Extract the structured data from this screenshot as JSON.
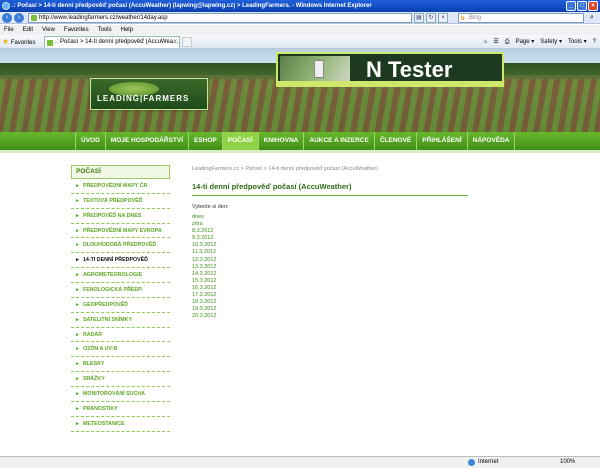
{
  "window": {
    "title": ".: Počasí > 14-ti denní předpověď počasí (AccuWeather) (lapwing@lapwing.cz) > LeadingFarmers. - Windows Internet Explorer"
  },
  "browser": {
    "url": "http://www.leadingfarmers.cz/weather/14day.asp",
    "search_placeholder": "Bing",
    "menu": [
      "File",
      "Edit",
      "View",
      "Favorites",
      "Tools",
      "Help"
    ],
    "favorites_label": "Favorites",
    "tab_title": ".: Počasí > 14-ti denní předpověď (AccuWea...",
    "commands": [
      "Page ▾",
      "Safety ▾",
      "Tools ▾"
    ],
    "status_zone": "Internet",
    "zoom": "100%"
  },
  "site": {
    "logo_text": "LEADING|FARMERS",
    "ad_title": "N Tester",
    "nav": [
      "ÚVOD",
      "MOJE HOSPODÁŘSTVÍ",
      "ESHOP",
      "POČASÍ",
      "KNIHOVNA",
      "AUKCE A INZERCE",
      "ČLENOVÉ",
      "PŘIHLÁŠENÍ",
      "NÁPOVĚDA"
    ],
    "nav_active_index": 3
  },
  "sidebar": {
    "title": "POČASÍ",
    "items": [
      "PŘEDPOVĚDNÍ MAPY ČR",
      "TEXTOVÁ PŘEDPOVĚĎ",
      "PŘEDPOVĚĎ NA DNES",
      "PŘEDPOVĚDNÍ MAPY EVROPA",
      "DLOUHODOBÁ PŘEDPOVĚĎ",
      "14-TI DENNÍ PŘEDPOVĚĎ",
      "AGROMETEOROLOGIE",
      "FENOLOGICKÁ PŘEDP.",
      "GEOPŘEDPOVĚĎ",
      "SATELITNÍ SNÍMKY",
      "RADAR",
      "OZÓN A UV-B",
      "BLESKY",
      "SRÁŽKY",
      "MONITOROVÁNÍ SUCHA",
      "PRANOSTIKY",
      "METEOSTANICE"
    ],
    "active_index": 5
  },
  "content": {
    "breadcrumb": "LeadingFarmers.cz > Počasí > 14-ti denní předpověď počasí (AccuWeather)",
    "heading": "14-ti denní předpověď počasí (AccuWeather)",
    "prompt": "Vyberte si den:",
    "dates": [
      "dnes",
      "zítra",
      "8.3.2012",
      "9.3.2012",
      "10.3.2012",
      "11.3.2012",
      "12.3.2012",
      "13.3.2012",
      "14.3.2012",
      "15.3.2012",
      "16.3.2012",
      "17.3.2012",
      "18.3.2012",
      "19.3.2012",
      "20.3.2012"
    ]
  }
}
